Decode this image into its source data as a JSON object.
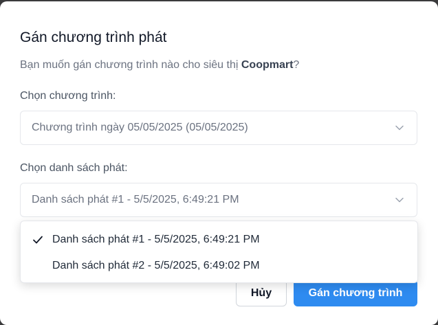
{
  "dialog": {
    "title": "Gán chương trình phát",
    "subtitle_prefix": "Bạn muốn gán chương trình nào cho siêu thị ",
    "store_name": "Coopmart",
    "subtitle_suffix": "?"
  },
  "program_select": {
    "label": "Chọn chương trình:",
    "value": "Chương trình ngày 05/05/2025 (05/05/2025)",
    "icon": "chevron-down-icon"
  },
  "playlist_select": {
    "label": "Chọn danh sách phát:",
    "value": "Danh sách phát #1 - 5/5/2025, 6:49:21 PM",
    "icon": "chevron-down-icon",
    "options": [
      {
        "label": "Danh sách phát #1 - 5/5/2025, 6:49:21 PM",
        "selected": true
      },
      {
        "label": "Danh sách phát #2 - 5/5/2025, 6:49:02 PM",
        "selected": false
      }
    ]
  },
  "buttons": {
    "cancel": "Hủy",
    "submit": "Gán chương trình"
  },
  "colors": {
    "primary": "#2e8bf0",
    "overlay": "#3a3a3c"
  }
}
